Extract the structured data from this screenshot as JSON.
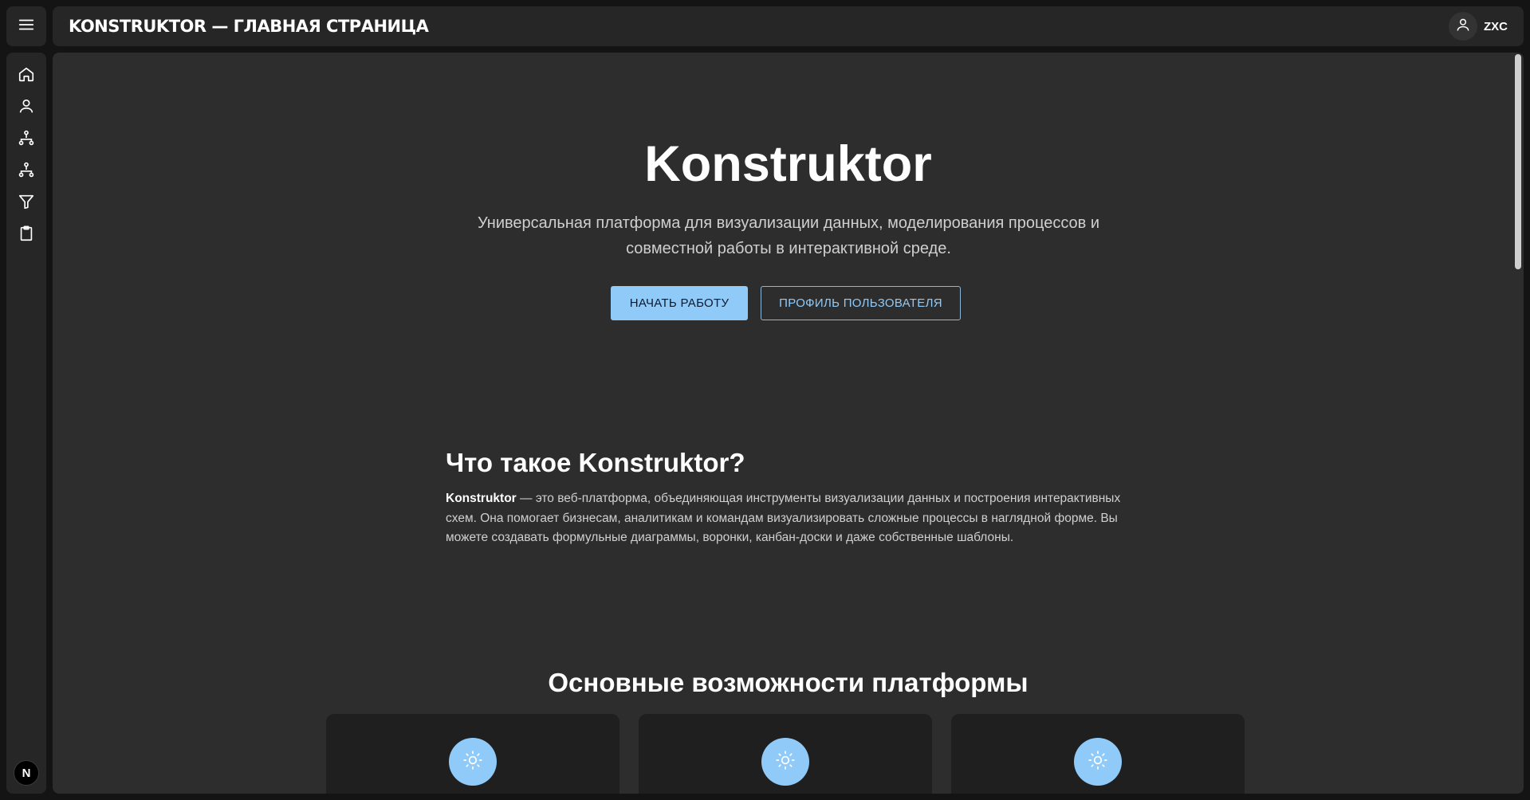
{
  "header": {
    "title": "KONSTRUKTOR — ГЛАВНАЯ СТРАНИЦА",
    "username": "ZXC"
  },
  "sidebar": {
    "items": [
      {
        "icon": "home-icon"
      },
      {
        "icon": "user-icon"
      },
      {
        "icon": "hierarchy-icon"
      },
      {
        "icon": "hierarchy-icon"
      },
      {
        "icon": "filter-icon"
      },
      {
        "icon": "clipboard-icon"
      }
    ],
    "bottom_badge": "N"
  },
  "hero": {
    "title": "Konstruktor",
    "subtitle": "Универсальная платформа для визуализации данных, моделирования процессов и совместной работы в интерактивной среде.",
    "primary_button": "Начать работу",
    "secondary_button": "Профиль пользователя"
  },
  "about": {
    "heading": "Что такое Konstruktor?",
    "strong": "Konstruktor",
    "text": " — это веб-платформа, объединяющая инструменты визуализации данных и построения интерактивных схем. Она помогает бизнесам, аналитикам и командам визуализировать сложные процессы в наглядной форме. Вы можете создавать формульные диаграммы, воронки, канбан-доски и даже собственные шаблоны."
  },
  "features": {
    "heading": "Основные возможности платформы",
    "cards": [
      {
        "icon": "sun-icon"
      },
      {
        "icon": "sun-icon"
      },
      {
        "icon": "sun-icon"
      }
    ]
  },
  "colors": {
    "accent": "#90caf9",
    "background": "#141414",
    "panel": "#262626",
    "content": "#2d2d2d",
    "card": "#1f1f1f"
  }
}
